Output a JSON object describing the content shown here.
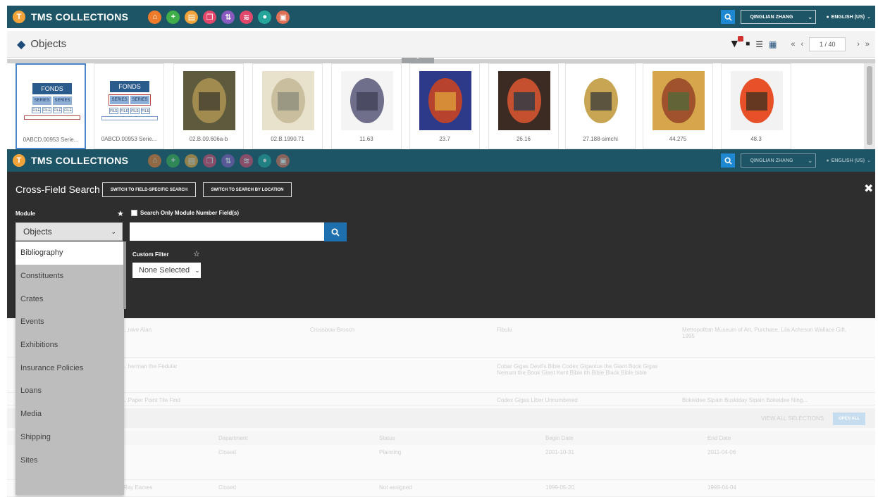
{
  "topbar": {
    "brand": "TMS COLLECTIONS",
    "brand_logo_icon": "tms-logo-icon",
    "nav_icons": [
      {
        "name": "home-icon",
        "color": "#f07b2a",
        "glyph": "⌂"
      },
      {
        "name": "add-icon",
        "color": "#3fae49",
        "glyph": "+"
      },
      {
        "name": "document-icon",
        "color": "#f2a43a",
        "glyph": "▤"
      },
      {
        "name": "copy-icon",
        "color": "#e0476b",
        "glyph": "❐"
      },
      {
        "name": "sort-icon",
        "color": "#8a5bbf",
        "glyph": "⇅"
      },
      {
        "name": "layers-icon",
        "color": "#e0476b",
        "glyph": "≋"
      },
      {
        "name": "info-icon",
        "color": "#26a69a",
        "glyph": "●"
      },
      {
        "name": "screen-icon",
        "color": "#e07055",
        "glyph": "▣"
      }
    ],
    "user": "QINGLIAN ZHANG",
    "language": "ENGLISH (US)"
  },
  "objects_bar": {
    "title": "Objects",
    "pager": "1 / 40"
  },
  "thumbnails": [
    {
      "label": "0ABCD.00953 Serie...",
      "kind": "hierarchy",
      "selected": true,
      "outline": "items"
    },
    {
      "label": "0ABCD.00953 Serie...",
      "kind": "hierarchy",
      "selected": false,
      "outline": "series"
    },
    {
      "label": "02.B.09.606a-b",
      "kind": "image",
      "colors": [
        "#5d5a3e",
        "#a28b4f",
        "#3c3a2c"
      ]
    },
    {
      "label": "02.B.1990.71",
      "kind": "image",
      "colors": [
        "#e8e1cc",
        "#c9bf9f",
        "#8a8a7a"
      ]
    },
    {
      "label": "11.63",
      "kind": "image",
      "colors": [
        "#f4f4f4",
        "#6f6f8c",
        "#3f3f56"
      ]
    },
    {
      "label": "23.7",
      "kind": "image",
      "colors": [
        "#2d3a8a",
        "#b7422e",
        "#e0a43a"
      ]
    },
    {
      "label": "26.16",
      "kind": "image",
      "colors": [
        "#3c2b22",
        "#c55030",
        "#1f3a4a"
      ]
    },
    {
      "label": "27.188-simchi",
      "kind": "image",
      "colors": [
        "#ffffff",
        "#c8a552",
        "#3a3a3a"
      ]
    },
    {
      "label": "44.275",
      "kind": "image",
      "colors": [
        "#d6a64d",
        "#a0522d",
        "#4e6b3a"
      ]
    },
    {
      "label": "48.3",
      "kind": "image",
      "colors": [
        "#f2f2f2",
        "#e8502a",
        "#3a3020"
      ]
    }
  ],
  "hierarchy": {
    "fonds": "FONDS",
    "series": "SERIES",
    "file": "FILE"
  },
  "search_panel": {
    "title": "Cross-Field Search",
    "switch_field": "SWITCH TO FIELD-SPECIFIC SEARCH",
    "switch_location": "SWITCH TO SEARCH BY LOCATION",
    "module_label": "Module",
    "module_value": "Objects",
    "checkbox_label": "Search Only Module Number Field(s)",
    "search_placeholder": "",
    "custom_filter_label": "Custom Filter",
    "custom_filter_value": "None Selected"
  },
  "module_options": [
    "Bibliography",
    "Constituents",
    "Crates",
    "Events",
    "Exhibitions",
    "Insurance Policies",
    "Loans",
    "Media",
    "Shipping",
    "Sites"
  ],
  "results_faded": {
    "row1": [
      "...rave Alan",
      "Crossbow Brooch",
      "Fibula",
      "Metropolitan Museum of Art, Purchase, Lila Acheson Wallace Gift, 1995"
    ],
    "row2": [
      "...herman the Fedular",
      "Cobar Gigas Devil's Bible Codex Gigantus the Giant Book Gigas Neinum the Book Giant Kent Bible ith Bible Black Bible bible",
      ""
    ],
    "row3": [
      "...Paper Point Tile Find",
      "Codex Gigas Liber Unnumbered",
      "Bokeidee Sipain Buskiday Sipain Bokeidee Ning..."
    ],
    "table_headers": [
      "Department",
      "Status",
      "Begin Date",
      "End Date"
    ],
    "table_row1": [
      "Closed",
      "Planning",
      "2001-10-31",
      "2011-04-06"
    ],
    "table_row2": [
      "Ray Eames",
      "Closed",
      "Not assigned",
      "1999-05-20",
      "1999-04-04"
    ],
    "open_all": "OPEN ALL",
    "view_action": "VIEW ALL SELECTIONS"
  }
}
